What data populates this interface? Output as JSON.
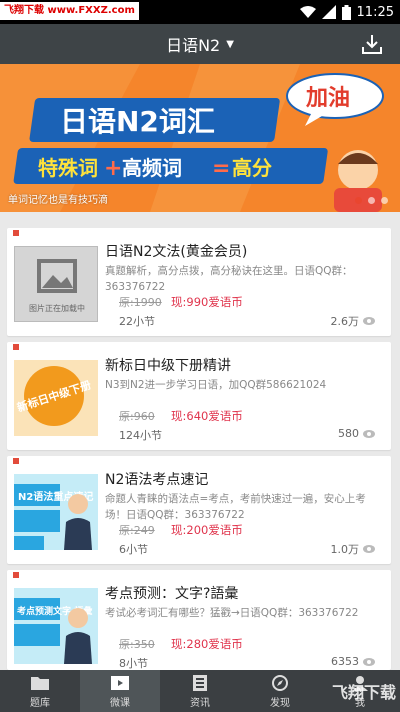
{
  "status_bar": {
    "watermark": "飞翔下载 www.FXXZ.com",
    "time": "11:25"
  },
  "header": {
    "title": "日语N2"
  },
  "banner": {
    "headline": "日语N2词汇",
    "tagline_part1": "特殊词",
    "tagline_part2": "高频词",
    "tagline_part3": "高分",
    "bubble": "加油",
    "caption": "单词记忆也是有技巧滴"
  },
  "courses": [
    {
      "title": "日语N2文法(黄金会员)",
      "desc": "真题解析，高分点拨，高分秘诀在这里。日语QQ群：363376722",
      "old_price": "原:1990",
      "new_price": "现:990爱语币",
      "sections": "22小节",
      "views": "2.6万",
      "thumb_text": "图片正在加载中"
    },
    {
      "title": "新标日中级下册精讲",
      "desc": "N3到N2进一步学习日语，加QQ群586621024",
      "old_price": "原:960",
      "new_price": "现:640爱语币",
      "sections": "124小节",
      "views": "580",
      "thumb_text": "新标日中级下册"
    },
    {
      "title": "N2语法考点速记",
      "desc": "命题人青睐的语法点=考点，考前快速过一遍，安心上考场！日语QQ群：363376722",
      "old_price": "原:249",
      "new_price": "现:200爱语币",
      "sections": "6小节",
      "views": "1.0万",
      "thumb_text": "N2语法重点速记"
    },
    {
      "title": "考点预测：文字?語彙",
      "desc": "考试必考词汇有哪些？猛戳→日语QQ群：363376722",
      "old_price": "原:350",
      "new_price": "现:280爱语币",
      "sections": "8小节",
      "views": "6353",
      "thumb_text": "考点预测文字·語彙"
    }
  ],
  "nav": [
    "题库",
    "微课",
    "资讯",
    "发现",
    "我"
  ],
  "watermark_br": "飞翔下载"
}
